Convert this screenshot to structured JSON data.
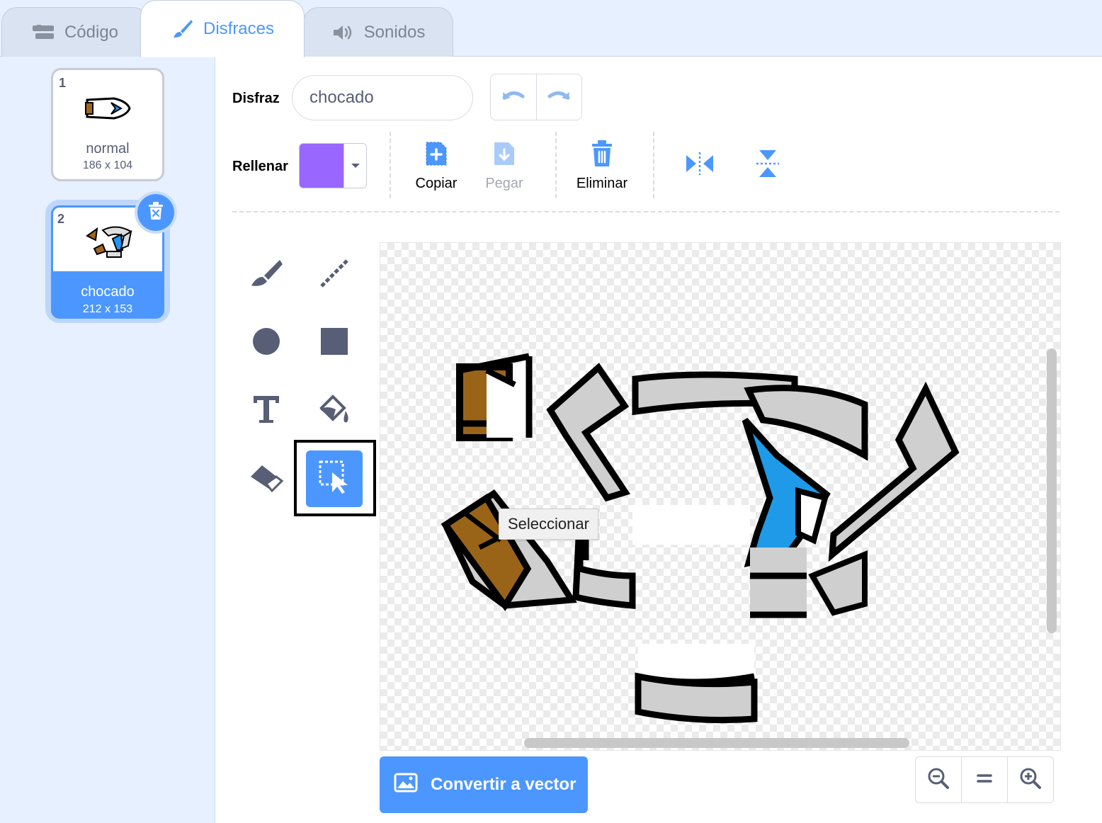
{
  "tabs": {
    "code": "Código",
    "costumes": "Disfraces",
    "sounds": "Sonidos"
  },
  "costumes": [
    {
      "number": "1",
      "name": "normal",
      "size": "186 x 104"
    },
    {
      "number": "2",
      "name": "chocado",
      "size": "212 x 153",
      "selected": true
    }
  ],
  "editor": {
    "costume_label": "Disfraz",
    "costume_name": "chocado",
    "fill_label": "Rellenar",
    "fill_color": "#9966ff",
    "copy_label": "Copiar",
    "paste_label": "Pegar",
    "delete_label": "Eliminar",
    "tooltip": "Seleccionar",
    "convert_label": "Convertir a vector"
  },
  "colors": {
    "accent": "#4c97ff",
    "tool_gray": "#575e75"
  },
  "icons": {
    "tabs": [
      "code-blocks-icon",
      "paintbrush-icon",
      "speaker-icon"
    ],
    "paint_tools": [
      "brush-icon",
      "line-icon",
      "circle-icon",
      "rectangle-icon",
      "text-icon",
      "fill-bucket-icon",
      "eraser-icon",
      "select-icon"
    ],
    "actions": [
      "copy-icon",
      "paste-icon",
      "trash-icon",
      "flip-horizontal-icon",
      "flip-vertical-icon"
    ],
    "zoom": [
      "zoom-out-icon",
      "zoom-reset-icon",
      "zoom-in-icon"
    ]
  }
}
